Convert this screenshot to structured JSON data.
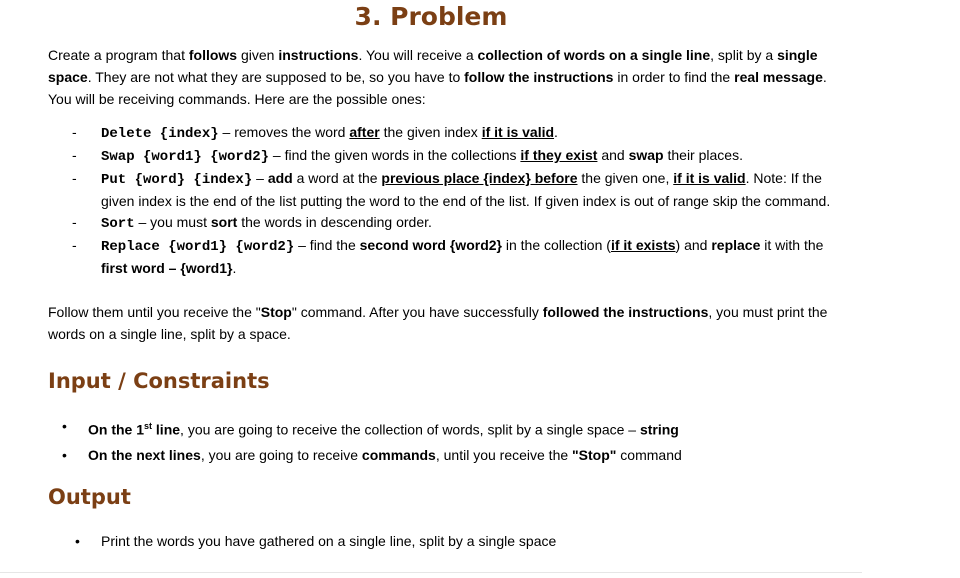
{
  "title": "3. Problem",
  "intro": {
    "t1": "Create a program that ",
    "b1": "follows",
    "t2": " given ",
    "b2": "instructions",
    "t3": ". You will receive a ",
    "b3": "collection of words on a single line",
    "t4": ", split by a ",
    "b4": "single space",
    "t5": ". They are not what they are supposed to be, so you have to ",
    "b5": "follow the instructions",
    "t6": " in order to find the ",
    "b6": "real message",
    "t7": ". You will be receiving commands. Here are the possible ones:"
  },
  "commands": {
    "delete": {
      "cmd": "Delete {index}",
      "t1": " – removes the word ",
      "u1": "after",
      "t2": " the given index ",
      "u2": "if it is valid",
      "t3": "."
    },
    "swap": {
      "cmd": "Swap {word1} {word2}",
      "t1": " – find the given words in the collections ",
      "u1": "if they exist",
      "t2": " and ",
      "b1": "swap",
      "t3": " their places."
    },
    "put": {
      "cmd": "Put {word} {index}",
      "t1": " – ",
      "b1": "add",
      "t2": " a word at the ",
      "u1": "previous place {index} before",
      "t3": " the given one, ",
      "u2": "if it is valid",
      "t4": ". Note: If the given index is the end of the list putting the word to the end of the list. If given index is out of range skip the command."
    },
    "sort": {
      "cmd": "Sort",
      "t1": " – you must ",
      "b1": "sort",
      "t2": " the words in descending order."
    },
    "replace": {
      "cmd": "Replace {word1} {word2}",
      "t1": " – find the ",
      "b1": "second word {word2}",
      "t2": " in the collection (",
      "u1": "if it exists",
      "t3": ") and ",
      "b2": "replace",
      "t4": " it with the ",
      "b3": "first word – {word1}",
      "t5": "."
    }
  },
  "follow": {
    "t1": "Follow them until you receive the \"",
    "b1": "Stop",
    "t2": "\" command. After you have successfully ",
    "b2": "followed the instructions",
    "t3": ", you must print the words on a single line, split by a space."
  },
  "input_section": {
    "heading": "Input / Constraints",
    "bullet1": {
      "b1": "On the 1",
      "sup": "st",
      "b2": " line",
      "t1": ", you are going to receive the collection of words, split by a single space – ",
      "b3": "string"
    },
    "bullet2": {
      "b1": "On the next lines",
      "t1": ", you are going to receive ",
      "b2": "commands",
      "t2": ", until you receive the ",
      "b3": "\"Stop\"",
      "t3": " command"
    }
  },
  "output_section": {
    "heading": "Output",
    "bullet1": "Print the words you have gathered on a single line, split by a single space"
  },
  "glyphs": {
    "dash": "-",
    "bullet": "•"
  },
  "colors": {
    "heading": "#7b3f14"
  }
}
